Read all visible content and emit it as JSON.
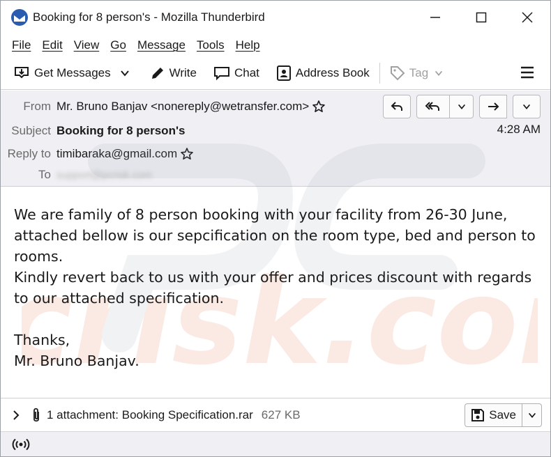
{
  "window": {
    "title": "Booking for 8 person's - Mozilla Thunderbird"
  },
  "menu": [
    "File",
    "Edit",
    "View",
    "Go",
    "Message",
    "Tools",
    "Help"
  ],
  "toolbar": {
    "get_messages": "Get Messages",
    "write": "Write",
    "chat": "Chat",
    "address_book": "Address Book",
    "tag": "Tag"
  },
  "header": {
    "from_label": "From",
    "from_value": "Mr. Bruno Banjav <nonereply@wetransfer.com>",
    "subject_label": "Subject",
    "subject_value": "Booking for 8 person's",
    "reply_to_label": "Reply to",
    "reply_to_value": "timibaraka@gmail.com",
    "to_label": "To",
    "to_value": "support@pcrisk.com",
    "time": "4:28 AM"
  },
  "body": {
    "text": "We are family of 8 person booking with your facility from 26-30 June,\nattached bellow is our sepcification on the room type, bed and person to\nrooms.\nKindly revert back to us with your offer and prices discount with regards\nto our attached specification.\n\nThanks,\nMr. Bruno Banjav."
  },
  "attachment": {
    "label": "1 attachment: Booking Specification.rar",
    "size": "627 KB",
    "save_label": "Save"
  },
  "icons": {
    "app": "thunderbird-icon",
    "minimize": "minimize-icon",
    "maximize": "maximize-icon",
    "close": "close-icon"
  },
  "watermark": "pcrisk.com"
}
